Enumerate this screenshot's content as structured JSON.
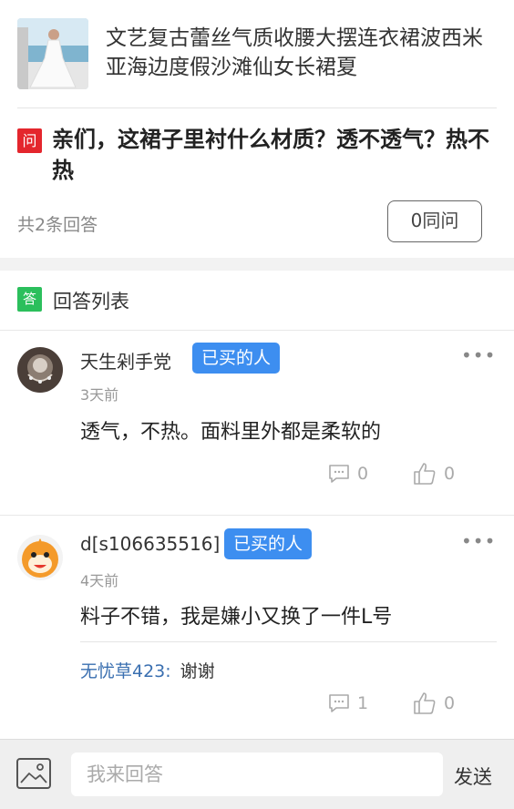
{
  "product": {
    "title": "文艺复古蕾丝气质收腰大摆连衣裙波西米亚海边度假沙滩仙女长裙夏"
  },
  "question": {
    "badge": "问",
    "text": "亲们，这裙子里衬什么材质？透不透气？热不热",
    "answer_count": "共2条回答",
    "same_question_label": "0同问"
  },
  "answers_section": {
    "badge": "答",
    "title": "回答列表"
  },
  "answers": [
    {
      "username": "天生剁手党",
      "buyer_tag": "已买的人",
      "more": "•••",
      "time": "3天前",
      "content": "透气，不热。面料里外都是柔软的",
      "comment_count": "0",
      "like_count": "0"
    },
    {
      "username": "d[s106635516]",
      "buyer_tag": "已买的人",
      "more": "•••",
      "time": "4天前",
      "content": "料子不错，我是嫌小又换了一件L号",
      "reply_user": "无忧草423:",
      "reply_text": "谢谢",
      "comment_count": "1",
      "like_count": "0"
    }
  ],
  "input_bar": {
    "placeholder": "我来回答",
    "send_label": "发送"
  },
  "colors": {
    "question_badge": "#e4262d",
    "answer_badge": "#2bbf5c",
    "buyer_tag": "#3d8ef0",
    "reply_user": "#3a6fb0"
  }
}
